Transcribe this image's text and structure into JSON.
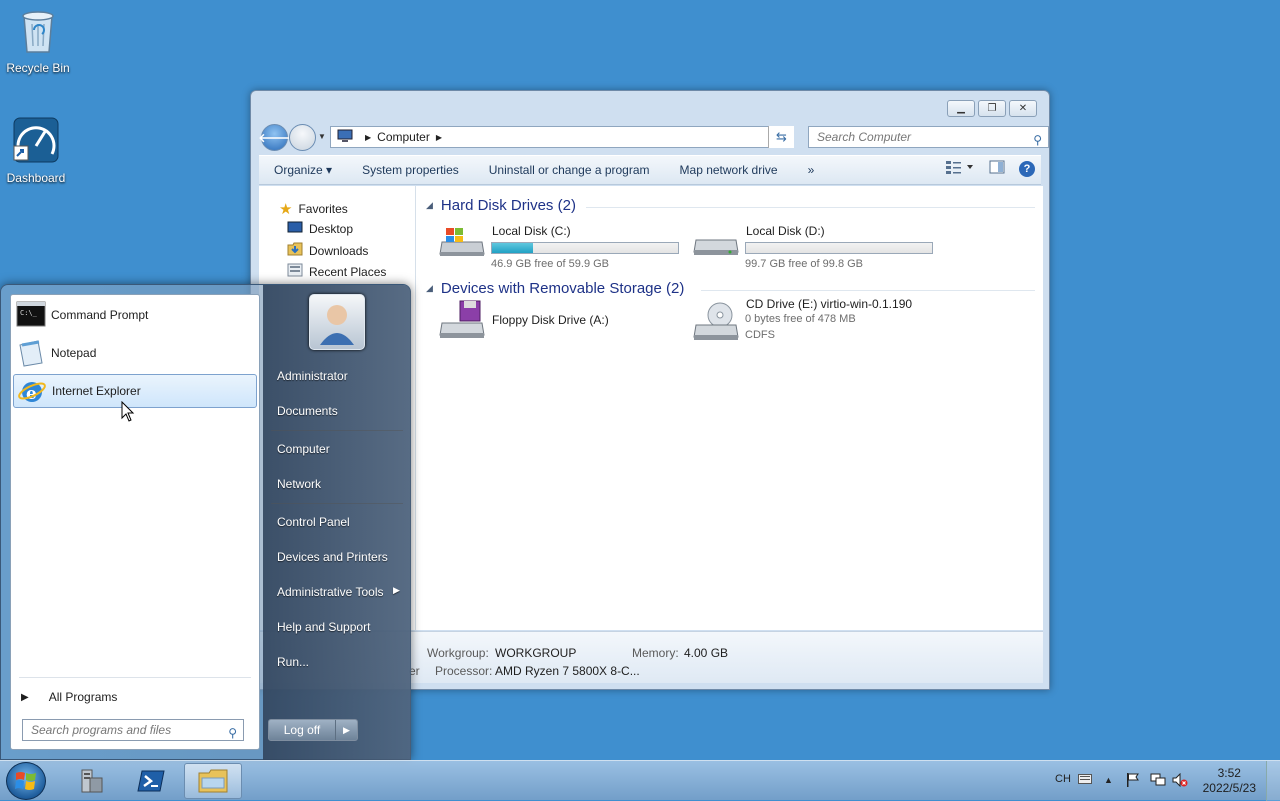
{
  "desktop": {
    "icons": [
      {
        "label": "Recycle Bin",
        "icon": "recycle-bin-icon"
      },
      {
        "label": "Dashboard",
        "icon": "dashboard-icon"
      }
    ]
  },
  "explorer": {
    "address": {
      "location": "Computer"
    },
    "search_placeholder": "Search Computer",
    "toolbar": {
      "organize": "Organize",
      "system_properties": "System properties",
      "uninstall": "Uninstall or change a program",
      "map_drive": "Map network drive",
      "more": "»"
    },
    "nav_pane": {
      "favorites": "Favorites",
      "items": [
        "Desktop",
        "Downloads",
        "Recent Places"
      ]
    },
    "groups": {
      "hdd": {
        "title": "Hard Disk Drives (2)",
        "drives": [
          {
            "name": "Local Disk (C:)",
            "free": "46.9 GB free of 59.9 GB",
            "used_fraction": 0.22
          },
          {
            "name": "Local Disk (D:)",
            "free": "99.7 GB free of 99.8 GB",
            "used_fraction": 0.001
          }
        ]
      },
      "removable": {
        "title": "Devices with Removable Storage (2)",
        "drives": [
          {
            "name": "Floppy Disk Drive (A:)"
          },
          {
            "name": "CD Drive (E:) virtio-win-0.1.190",
            "free": "0 bytes free of 478 MB",
            "fs": "CDFS"
          }
        ]
      }
    },
    "details": {
      "workgroup_label": "Workgroup:",
      "workgroup": "WORKGROUP",
      "memory_label": "Memory:",
      "memory": "4.00 GB",
      "processor_label": "Processor:",
      "processor": "AMD Ryzen 7 5800X 8-C...",
      "partial_left": "er"
    }
  },
  "start_menu": {
    "programs": [
      "Command Prompt",
      "Notepad",
      "Internet Explorer"
    ],
    "all_programs": "All Programs",
    "search_placeholder": "Search programs and files",
    "right_links": {
      "user": "Administrator",
      "documents": "Documents",
      "computer": "Computer",
      "network": "Network",
      "control_panel": "Control Panel",
      "devices": "Devices and Printers",
      "admin_tools": "Administrative Tools",
      "help": "Help and Support",
      "run": "Run..."
    },
    "logoff": "Log off"
  },
  "taskbar": {
    "language": "CH",
    "time": "3:52",
    "date": "2022/5/23"
  },
  "colors": {
    "desktop": "#3f8fcf",
    "accent": "#1e3287",
    "bar_fill": "#21a1c4"
  }
}
